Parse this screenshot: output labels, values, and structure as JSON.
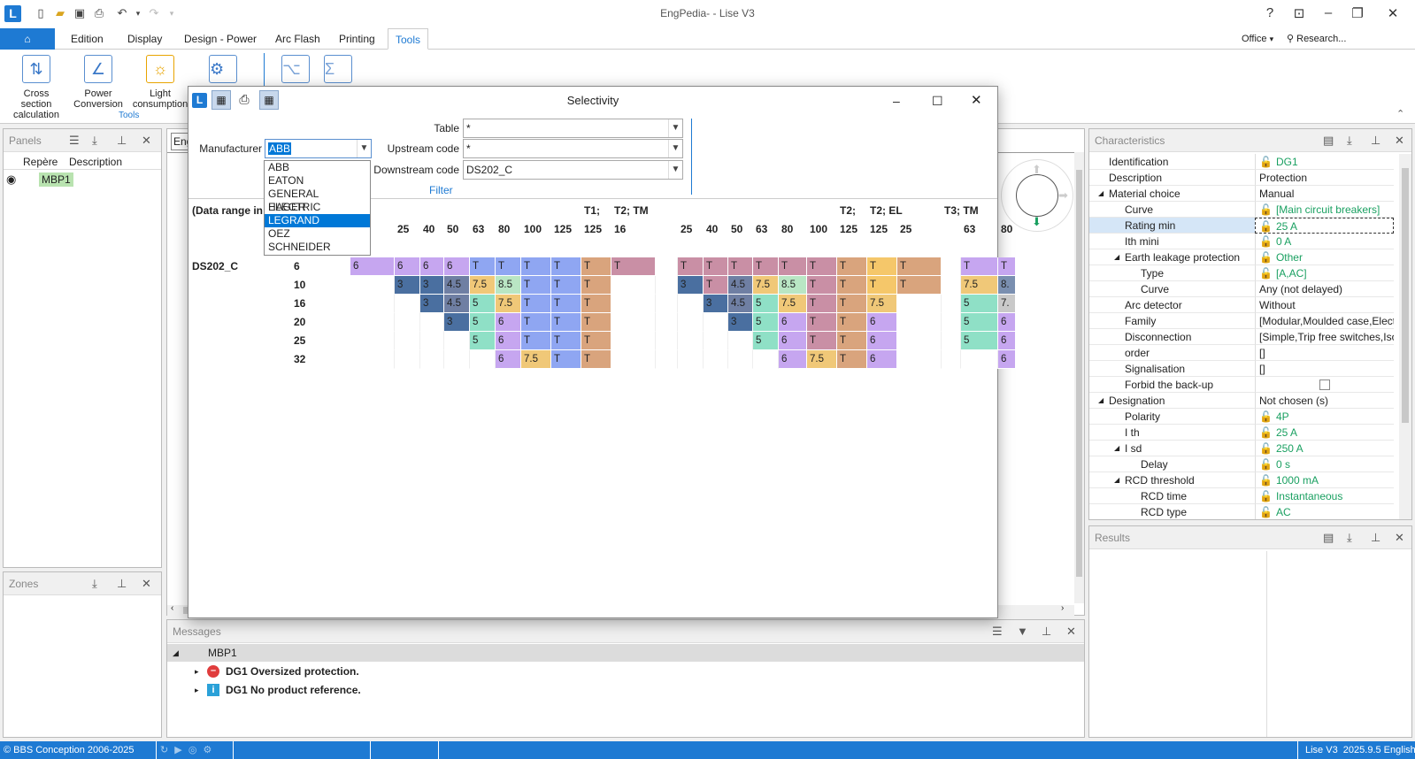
{
  "app": {
    "title": "EngPedia- - Lise V3",
    "logo": "L"
  },
  "window_controls": {
    "help": "?",
    "restore_ribbon": "⊡",
    "minimize": "–",
    "maximize": "❐",
    "close": "✕"
  },
  "menu": {
    "home_icon": "home-icon",
    "items": [
      "Edition",
      "Display",
      "Design - Power",
      "Arc Flash",
      "Printing",
      "Tools"
    ],
    "active": "Tools",
    "office": "Office",
    "search": "Research..."
  },
  "ribbon": {
    "buttons": [
      {
        "label1": "Cross section",
        "label2": "calculation",
        "icon": "cross-section-icon"
      },
      {
        "label1": "Power",
        "label2": "Conversion",
        "icon": "power-conversion-icon"
      },
      {
        "label1": "Light",
        "label2": "consumption",
        "icon": "light-consumption-icon"
      }
    ],
    "group": "Tools"
  },
  "panels": {
    "title": "Panels",
    "col1": "Repère",
    "col2": "Description",
    "row1": "MBP1"
  },
  "zones": {
    "title": "Zones"
  },
  "tab_stub": "Eng",
  "characteristics": {
    "title": "Characteristics",
    "rows": [
      {
        "k": "Identification",
        "v": "DG1",
        "lock": true,
        "indent": 0,
        "exp": ""
      },
      {
        "k": "Description",
        "v": "Protection",
        "lock": false,
        "indent": 0,
        "exp": ""
      },
      {
        "k": "Material choice",
        "v": "Manual",
        "lock": false,
        "indent": 0,
        "exp": "◢"
      },
      {
        "k": "Curve",
        "v": "[Main circuit breakers]",
        "lock": true,
        "indent": 1,
        "exp": ""
      },
      {
        "k": "Rating min",
        "v": "25 A",
        "lock": true,
        "indent": 1,
        "exp": ""
      },
      {
        "k": "Ith mini",
        "v": "0 A",
        "lock": true,
        "indent": 1,
        "exp": ""
      },
      {
        "k": "Earth leakage protection",
        "v": "Other",
        "lock": true,
        "indent": 1,
        "exp": "◢"
      },
      {
        "k": "Type",
        "v": "[A,AC]",
        "lock": true,
        "indent": 2,
        "exp": ""
      },
      {
        "k": "Curve",
        "v": "Any (not delayed)",
        "lock": false,
        "indent": 2,
        "exp": ""
      },
      {
        "k": "Arc detector",
        "v": "Without",
        "lock": false,
        "indent": 1,
        "exp": ""
      },
      {
        "k": "Family",
        "v": "[Modular,Moulded case,Electron",
        "lock": false,
        "indent": 1,
        "exp": ""
      },
      {
        "k": "Disconnection",
        "v": "[Simple,Trip free switches,Isolat",
        "lock": false,
        "indent": 1,
        "exp": ""
      },
      {
        "k": "order",
        "v": "[]",
        "lock": false,
        "indent": 1,
        "exp": ""
      },
      {
        "k": "Signalisation",
        "v": "[]",
        "lock": false,
        "indent": 1,
        "exp": ""
      },
      {
        "k": "Forbid the back-up",
        "v": "",
        "lock": false,
        "indent": 1,
        "exp": ""
      },
      {
        "k": "Designation",
        "v": "Not chosen (s)",
        "lock": false,
        "indent": 0,
        "exp": "◢"
      },
      {
        "k": "Polarity",
        "v": "4P",
        "lock": true,
        "indent": 1,
        "exp": ""
      },
      {
        "k": "I th",
        "v": "25 A",
        "lock": true,
        "indent": 1,
        "exp": ""
      },
      {
        "k": "I sd",
        "v": "250 A",
        "lock": true,
        "indent": 1,
        "exp": "◢"
      },
      {
        "k": "Delay",
        "v": "0 s",
        "lock": true,
        "indent": 2,
        "exp": ""
      },
      {
        "k": "RCD threshold",
        "v": "1000 mA",
        "lock": true,
        "indent": 1,
        "exp": "◢"
      },
      {
        "k": "RCD time",
        "v": "Instantaneous",
        "lock": true,
        "indent": 2,
        "exp": ""
      },
      {
        "k": "RCD type",
        "v": "AC",
        "lock": true,
        "indent": 2,
        "exp": ""
      }
    ]
  },
  "results": {
    "title": "Results"
  },
  "messages": {
    "title": "Messages",
    "group": "MBP1",
    "items": [
      {
        "icon": "error-icon",
        "text": "DG1 Oversized protection."
      },
      {
        "icon": "info-icon",
        "text": "DG1 No product reference."
      }
    ]
  },
  "status": {
    "copyright": "© BBS Conception 2006-2025",
    "version": "Lise V3  2025.9.5 English"
  },
  "dialog": {
    "title": "Selectivity",
    "logo": "L",
    "labels": {
      "manufacturer": "Manufacturer",
      "table": "Table",
      "upstream": "Upstream code",
      "downstream": "Downstream code",
      "filter": "Filter"
    },
    "values": {
      "manufacturer": "ABB",
      "table": "*",
      "upstream": "*",
      "downstream": "DS202_C"
    },
    "manufacturers": [
      "ABB",
      "EATON",
      "GENERAL ELECTRIC",
      "HAGER",
      "LEGRAND",
      "OEZ",
      "SCHNEIDER"
    ],
    "highlighted": "LEGRAND",
    "range_label": "(Data range in",
    "groups": [
      {
        "t": "TM",
        "col": 0
      },
      {
        "t": "T1;",
        "col": 8
      },
      {
        "t": "T2; TM",
        "col": 9
      },
      {
        "t": "T2;",
        "col": 17
      },
      {
        "t": "T2; EL",
        "col": 18
      },
      {
        "t": "T3; TM",
        "col": 20
      }
    ],
    "cols": [
      "",
      "25",
      "40",
      "50",
      "63",
      "80",
      "100",
      "125",
      "125",
      "16",
      "",
      "25",
      "40",
      "50",
      "63",
      "80",
      "100",
      "125",
      "125",
      "25",
      "",
      "63",
      "80"
    ],
    "row_label": "DS202_C",
    "rows": [
      {
        "r": "6",
        "c": [
          "6",
          "6",
          "6",
          "6",
          "T",
          "T",
          "T",
          "T",
          "T",
          "T",
          "",
          "T",
          "T",
          "T",
          "T",
          "T",
          "T",
          "T",
          "T",
          "T",
          "",
          "T",
          "T"
        ]
      },
      {
        "r": "10",
        "c": [
          "",
          "3",
          "3",
          "4.5",
          "7.5",
          "8.5",
          "T",
          "T",
          "T",
          "",
          "",
          "3",
          "T",
          "4.5",
          "7.5",
          "8.5",
          "T",
          "T",
          "T",
          "T",
          "",
          "7.5",
          "8."
        ]
      },
      {
        "r": "16",
        "c": [
          "",
          "",
          "3",
          "4.5",
          "5",
          "7.5",
          "T",
          "T",
          "T",
          "",
          "",
          "",
          "3",
          "4.5",
          "5",
          "7.5",
          "T",
          "T",
          "7.5",
          "",
          "",
          "5",
          "7."
        ]
      },
      {
        "r": "20",
        "c": [
          "",
          "",
          "",
          "3",
          "5",
          "6",
          "T",
          "T",
          "T",
          "",
          "",
          "",
          "",
          "3",
          "5",
          "6",
          "T",
          "T",
          "6",
          "",
          "",
          "5",
          "6"
        ]
      },
      {
        "r": "25",
        "c": [
          "",
          "",
          "",
          "",
          "5",
          "6",
          "T",
          "T",
          "T",
          "",
          "",
          "",
          "",
          "",
          "5",
          "6",
          "T",
          "T",
          "6",
          "",
          "",
          "5",
          "6"
        ]
      },
      {
        "r": "32",
        "c": [
          "",
          "",
          "",
          "",
          "",
          "6",
          "7.5",
          "T",
          "T",
          "",
          "",
          "",
          "",
          "",
          "",
          "6",
          "7.5",
          "T",
          "6",
          "",
          "",
          "",
          "6"
        ]
      }
    ]
  }
}
